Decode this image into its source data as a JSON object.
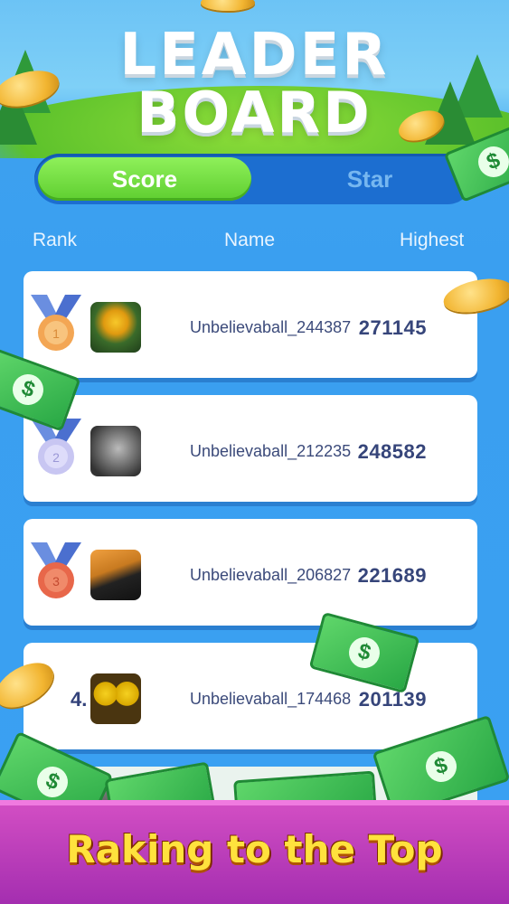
{
  "header": {
    "title_line1": "LEADER",
    "title_line2": "BOARD"
  },
  "tabs": [
    {
      "label": "Score",
      "active": true
    },
    {
      "label": "Star",
      "active": false
    }
  ],
  "columns": {
    "rank": "Rank",
    "name": "Name",
    "highest": "Highest"
  },
  "rows": [
    {
      "rank": "1",
      "name": "Unbelievaball_244387",
      "score": "271145",
      "medal": "gold"
    },
    {
      "rank": "2",
      "name": "Unbelievaball_212235",
      "score": "248582",
      "medal": "silver"
    },
    {
      "rank": "3",
      "name": "Unbelievaball_206827",
      "score": "221689",
      "medal": "bronze"
    },
    {
      "rank": "4.",
      "name": "Unbelievaball_174468",
      "score": "201139"
    }
  ],
  "banner": {
    "text": "Raking to the Top"
  },
  "icons": {
    "dollar": "$"
  },
  "colors": {
    "active_tab": "#6ad63a",
    "tab_track": "#1c6ed0",
    "banner": "#c03fbe",
    "banner_text": "#ffe23d"
  }
}
